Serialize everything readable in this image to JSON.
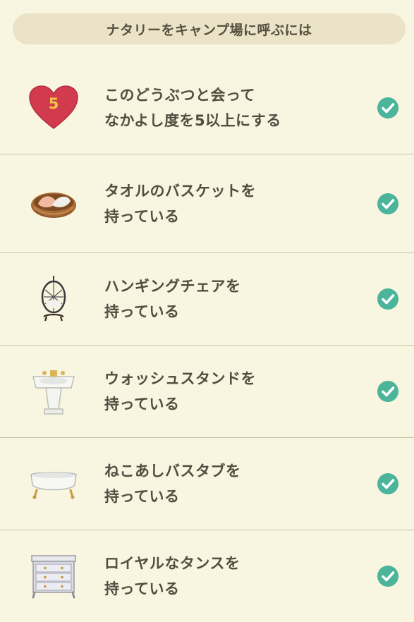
{
  "header": {
    "title": "ナタリーをキャンプ場に呼ぶには"
  },
  "items": [
    {
      "icon": "heart-icon",
      "heart_number": "5",
      "line1": "このどうぶつと会って",
      "line2": "なかよし度を5以上にする",
      "done": true
    },
    {
      "icon": "towel-basket-icon",
      "line1": "タオルのバスケットを",
      "line2": "持っている",
      "done": true
    },
    {
      "icon": "hanging-chair-icon",
      "line1": "ハンギングチェアを",
      "line2": "持っている",
      "done": true
    },
    {
      "icon": "wash-stand-icon",
      "line1": "ウォッシュスタンドを",
      "line2": "持っている",
      "done": true
    },
    {
      "icon": "clawfoot-bathtub-icon",
      "line1": "ねこあしバスタブを",
      "line2": "持っている",
      "done": true
    },
    {
      "icon": "royal-dresser-icon",
      "line1": "ロイヤルなタンスを",
      "line2": "持っている",
      "done": true
    }
  ],
  "colors": {
    "background": "#f8f5e1",
    "header_bg": "#ebe3c7",
    "check": "#4bb49a",
    "heart": "#d23a4e",
    "divider": "#c9c1a4"
  }
}
